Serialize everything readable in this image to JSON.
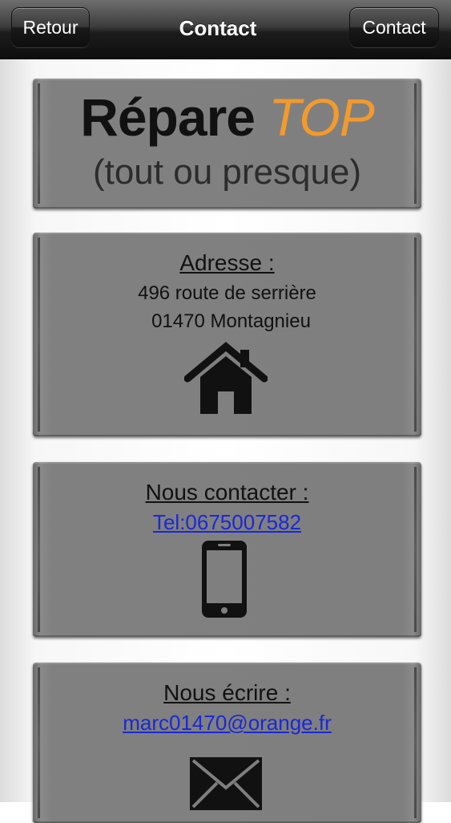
{
  "navbar": {
    "back_label": "Retour",
    "title": "Contact",
    "contact_label": "Contact"
  },
  "logo": {
    "word1": "Répare",
    "word2": "TOP",
    "subtitle": "(tout ou presque)",
    "accent_color": "#f39a2c"
  },
  "address": {
    "heading": "Adresse :",
    "line1": "496 route de serrière",
    "line2": "01470 Montagnieu",
    "icon": "home-icon"
  },
  "phone": {
    "heading": "Nous contacter :",
    "link": "Tel:0675007582",
    "icon": "smartphone-icon"
  },
  "mail": {
    "heading": "Nous écrire :",
    "link": "marc01470@orange.fr",
    "icon": "envelope-icon"
  },
  "colors": {
    "link": "#1a28d8",
    "card": "#7f7f7f"
  }
}
